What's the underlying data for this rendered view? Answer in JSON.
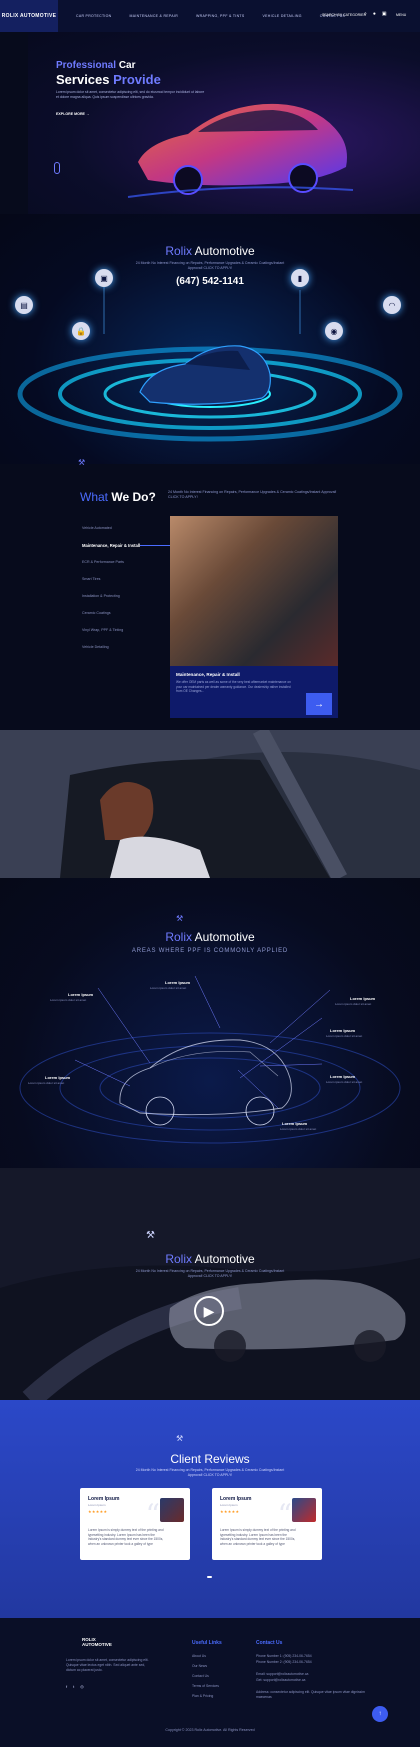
{
  "header": {
    "logo": "ROLIX AUTOMOTIVE",
    "nav": [
      "CAR PROTECTION",
      "MAINTENANCE & REPAIR",
      "WRAPPING, PPF & TINTS",
      "VEHICLE DETAILING",
      "CONTACT US"
    ],
    "search": "SEARCH BY CATEGORIES",
    "menu": "MENU",
    "cart_count": "0"
  },
  "hero": {
    "line1_a": "Professional",
    "line1_b": "Car",
    "line2_a": "Services",
    "line2_b": "Provide",
    "description": "Lorem ipsum dolor sit amet, consectetur adipiscing elit, sed do eiusmod tempor incididunt ut labore et dolore magna aliqua. Quis ipsum suspendisse ultrices gravida.",
    "button": "EXPLORE MORE →"
  },
  "connect": {
    "brand_a": "Rolix",
    "brand_b": "Automotive",
    "subtitle": "24 Month No Interest Financing on Repairs, Performance Upgrades & Ceramic Coatings/Instant Approval! CLICK TO APPLY!",
    "phone": "(647) 542-1141"
  },
  "services": {
    "title_a": "What",
    "title_b": "We Do?",
    "subtitle": "24 Month No Interest Financing on Repairs, Performance Upgrades & Ceramic Coatings/Instant Approval! CLICK TO APPLY!",
    "items": [
      "Vehicle Automated",
      "Maintenance, Repair & Install",
      "ECR & Performance Parts",
      "Smart Tires",
      "Installation & Protecting",
      "Ceramic Coatings",
      "Vinyl Wrap, PPF & Tinting",
      "Vehicle Detailing"
    ],
    "active_index": 1,
    "card_title": "Maintenance, Repair & Install",
    "card_text": "We offer OEM parts as well as some of the very best aftermarket maintenance on your car maintained per dealer warranty guidance. Our dealership rather installed from OE Changes..."
  },
  "ppf": {
    "brand_a": "Rolix",
    "brand_b": "Automotive",
    "subtitle": "AREAS WHERE PPF IS COMMONLY APPLIED",
    "callouts": [
      {
        "title": "Lorem Ipsum",
        "sub": "Lorem ipsum dolor sit amet"
      },
      {
        "title": "Lorem Ipsum",
        "sub": "Lorem ipsum dolor sit amet"
      },
      {
        "title": "Lorem Ipsum",
        "sub": "Lorem ipsum dolor sit amet"
      },
      {
        "title": "Lorem Ipsum",
        "sub": "Lorem ipsum dolor sit amet"
      },
      {
        "title": "Lorem Ipsum",
        "sub": "Lorem ipsum dolor sit amet"
      },
      {
        "title": "Lorem Ipsum",
        "sub": "Lorem ipsum dolor sit amet"
      },
      {
        "title": "Lorem Ipsum",
        "sub": "Lorem ipsum dolor sit amet"
      }
    ]
  },
  "video": {
    "brand_a": "Rolix",
    "brand_b": "Automotive",
    "subtitle": "24 Month No Interest Financing on Repairs, Performance Upgrades & Ceramic Coatings/Instant Approval! CLICK TO APPLY!"
  },
  "reviews": {
    "title": "Client Reviews",
    "subtitle": "24 Month No Interest Financing on Repairs, Performance Upgrades & Ceramic Coatings/Instant Approval! CLICK TO APPLY!",
    "cards": [
      {
        "name": "Lorem Ipsum",
        "role": "Lorem Ipsum",
        "stars": "★★★★★",
        "text": "Lorem Ipsum is simply dummy text of the printing and typesetting industry. Lorem Ipsum has been the industry's standard dummy text ever since the 1500s, when an unknown printer took a galley of type"
      },
      {
        "name": "Lorem Ipsum",
        "role": "Lorem Ipsum",
        "stars": "★★★★★",
        "text": "Lorem Ipsum is simply dummy text of the printing and typesetting industry. Lorem Ipsum has been the industry's standard dummy text ever since the 1500s, when an unknown printer took a galley of type"
      }
    ]
  },
  "footer": {
    "logo": "ROLIX AUTOMOTIVE",
    "about": "Lorem ipsum dolor sit amet, consectetur adipiscing elit. Quisque vitae lectus eget nibh. Sed aliquet ante sed, dictum ac placerat justo.",
    "links_title": "Useful Links",
    "links": [
      "About Us",
      "Our News",
      "Contact Us",
      "Terms of Services",
      "Plan & Pricing"
    ],
    "contact_title": "Contact Us",
    "phone1": "Phone Number 1: (905) 234-06-7654",
    "phone2": "Phone Number 2: (905) 234-06-7654",
    "email1": "Email: support@rolixautomotive.ca",
    "email2": "Get: support@rolixautomotive.ca",
    "address": "Address: consectetur adipiscing elit. Quisque vitae ipsum vitae dignissim maecenas",
    "copyright": "Copyright © 2023 Rolix Automotive. All Rights Reserved",
    "colors": {
      "accent": "#4b6cff",
      "bg": "#0a0f27"
    }
  }
}
